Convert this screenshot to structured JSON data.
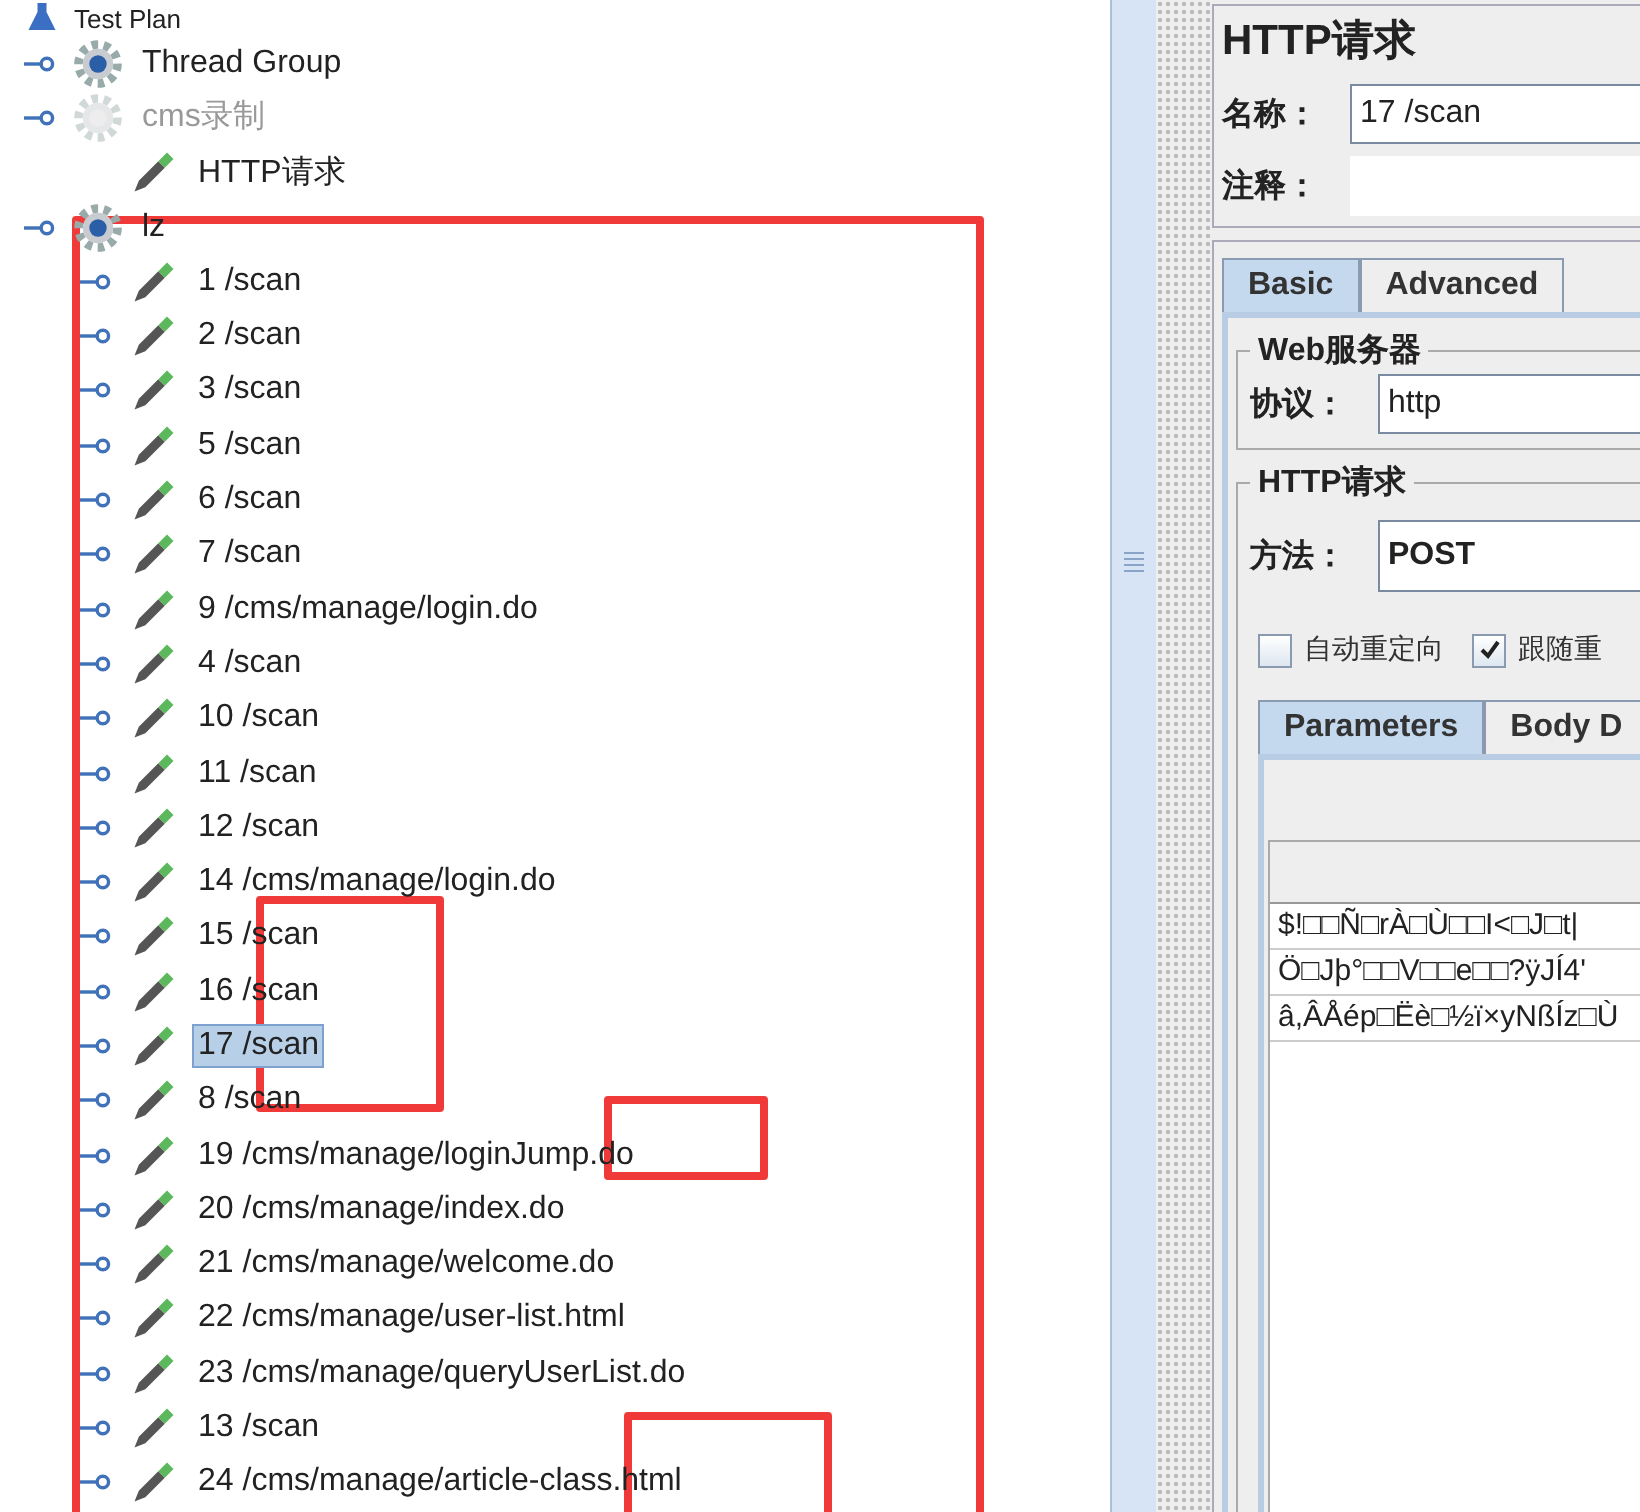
{
  "tree": [
    {
      "label": "Test Plan",
      "kind": "plan",
      "selected": false,
      "children": [
        {
          "label": "Thread Group",
          "kind": "group",
          "selected": false,
          "disabled": false
        },
        {
          "label": "cms录制",
          "kind": "group",
          "selected": false,
          "disabled": true,
          "children": [
            {
              "label": "HTTP请求",
              "kind": "sampler",
              "selected": false
            }
          ]
        },
        {
          "label": "lz",
          "kind": "group",
          "selected": false,
          "disabled": false,
          "children": [
            {
              "label": "1 /scan",
              "kind": "sampler",
              "selected": false
            },
            {
              "label": "2 /scan",
              "kind": "sampler",
              "selected": false
            },
            {
              "label": "3 /scan",
              "kind": "sampler",
              "selected": false
            },
            {
              "label": "5 /scan",
              "kind": "sampler",
              "selected": false
            },
            {
              "label": "6 /scan",
              "kind": "sampler",
              "selected": false
            },
            {
              "label": "7 /scan",
              "kind": "sampler",
              "selected": false
            },
            {
              "label": "9 /cms/manage/login.do",
              "kind": "sampler",
              "selected": false
            },
            {
              "label": "4 /scan",
              "kind": "sampler",
              "selected": false
            },
            {
              "label": "10 /scan",
              "kind": "sampler",
              "selected": false
            },
            {
              "label": "11 /scan",
              "kind": "sampler",
              "selected": false
            },
            {
              "label": "12 /scan",
              "kind": "sampler",
              "selected": false
            },
            {
              "label": "14 /cms/manage/login.do",
              "kind": "sampler",
              "selected": false
            },
            {
              "label": "15 /scan",
              "kind": "sampler",
              "selected": false
            },
            {
              "label": "16 /scan",
              "kind": "sampler",
              "selected": false
            },
            {
              "label": "17 /scan",
              "kind": "sampler",
              "selected": true
            },
            {
              "label": "8 /scan",
              "kind": "sampler",
              "selected": false
            },
            {
              "label": "19 /cms/manage/loginJump.do",
              "kind": "sampler",
              "selected": false
            },
            {
              "label": "20 /cms/manage/index.do",
              "kind": "sampler",
              "selected": false
            },
            {
              "label": "21 /cms/manage/welcome.do",
              "kind": "sampler",
              "selected": false
            },
            {
              "label": "22 /cms/manage/user-list.html",
              "kind": "sampler",
              "selected": false
            },
            {
              "label": "23 /cms/manage/queryUserList.do",
              "kind": "sampler",
              "selected": false
            },
            {
              "label": "13 /scan",
              "kind": "sampler",
              "selected": false
            },
            {
              "label": "24 /cms/manage/article-class.html",
              "kind": "sampler",
              "selected": false
            }
          ]
        }
      ]
    }
  ],
  "panel": {
    "title": "HTTP请求",
    "name_label": "名称：",
    "name_value": "17 /scan",
    "comment_label": "注释：",
    "tabs": [
      {
        "label": "Basic",
        "selected": true
      },
      {
        "label": "Advanced",
        "selected": false
      }
    ],
    "server_group": "Web服务器",
    "protocol_label": "协议：",
    "protocol_value": "http",
    "request_group": "HTTP请求",
    "method_label": "方法：",
    "method_value": "POST",
    "checkboxes": [
      {
        "label": "自动重定向",
        "checked": false
      },
      {
        "label": "跟随重",
        "checked": true
      }
    ],
    "sub_tabs": [
      {
        "label": "Parameters",
        "selected": true
      },
      {
        "label": "Body D",
        "selected": false
      }
    ],
    "body_lines": [
      "$!□□Ñ□rÀ□Ù□□I<□J□t|",
      "Ö□Jþ°□□V□□e□□?ÿJÍ4'",
      "â,ÂÅép□Ëè□½ï×yNßÍz□Ù"
    ]
  }
}
